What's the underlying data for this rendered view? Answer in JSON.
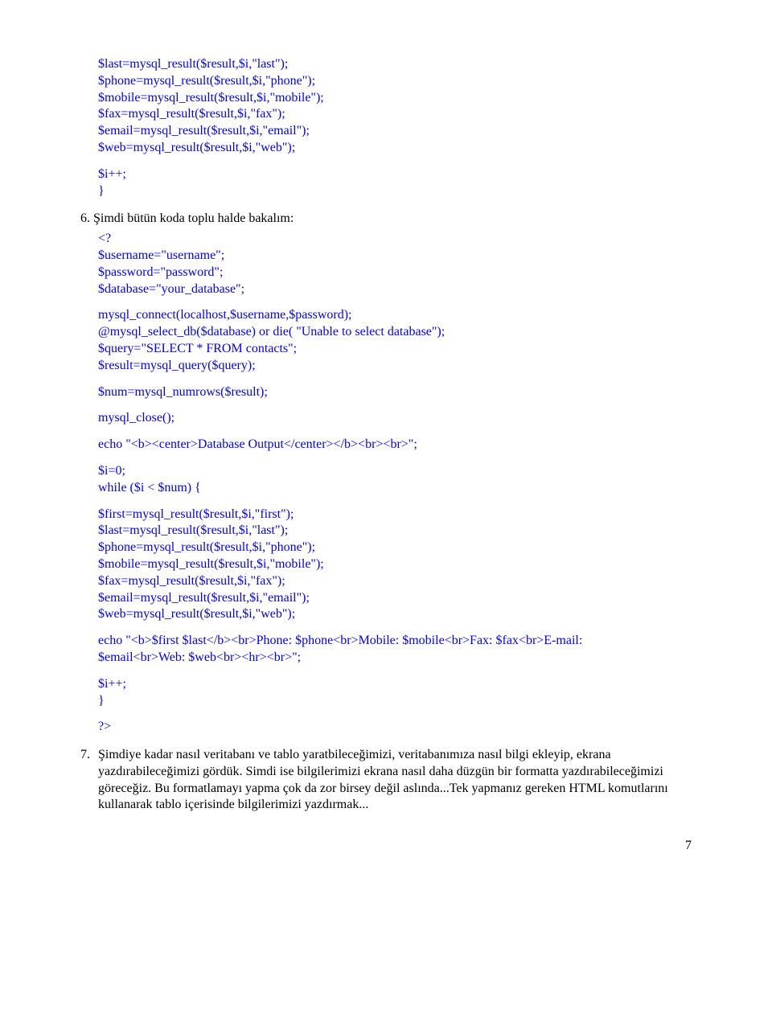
{
  "code": {
    "block1": {
      "l1": "$last=mysql_result($result,$i,\"last\");",
      "l2": "$phone=mysql_result($result,$i,\"phone\");",
      "l3": "$mobile=mysql_result($result,$i,\"mobile\");",
      "l4": "$fax=mysql_result($result,$i,\"fax\");",
      "l5": "$email=mysql_result($result,$i,\"email\");",
      "l6": "$web=mysql_result($result,$i,\"web\");"
    },
    "block2": {
      "l1": "$i++;",
      "l2": "}"
    },
    "item6_label": "6.",
    "item6_text": "Şimdi bütün koda toplu halde bakalım:",
    "block3": {
      "l1": "<?",
      "l2": "$username=\"username\";",
      "l3": "$password=\"password\";",
      "l4": "$database=\"your_database\";"
    },
    "block4": {
      "l1": "mysql_connect(localhost,$username,$password);",
      "l2": "@mysql_select_db($database) or die( \"Unable to select database\");",
      "l3": "$query=\"SELECT * FROM contacts\";",
      "l4": "$result=mysql_query($query);"
    },
    "block5": "$num=mysql_numrows($result);",
    "block6": "mysql_close();",
    "block7": "echo \"<b><center>Database Output</center></b><br><br>\";",
    "block8": {
      "l1": "$i=0;",
      "l2": "while ($i < $num) {"
    },
    "block9": {
      "l1": "$first=mysql_result($result,$i,\"first\");",
      "l2": "$last=mysql_result($result,$i,\"last\");",
      "l3": "$phone=mysql_result($result,$i,\"phone\");",
      "l4": "$mobile=mysql_result($result,$i,\"mobile\");",
      "l5": "$fax=mysql_result($result,$i,\"fax\");",
      "l6": "$email=mysql_result($result,$i,\"email\");",
      "l7": "$web=mysql_result($result,$i,\"web\");"
    },
    "block10": {
      "l1": "echo \"<b>$first $last</b><br>Phone: $phone<br>Mobile: $mobile<br>Fax: $fax<br>E-mail:",
      "l2": "$email<br>Web: $web<br><hr><br>\";"
    },
    "block11": {
      "l1": "$i++;",
      "l2": "}"
    },
    "block12": "?>"
  },
  "item7": {
    "label": "7.",
    "text": "Şimdiye kadar nasıl veritabanı ve tablo yaratbileceğimizi, veritabanımıza nasıl bilgi ekleyip, ekrana yazdırabileceğimizi gördük. Simdi ise bilgilerimizi ekrana nasıl daha düzgün bir formatta yazdırabileceğimizi göreceğiz. Bu formatlamayı yapma çok da zor birsey değil aslında...Tek yapmanız gereken HTML komutlarını kullanarak tablo içerisinde bilgilerimizi yazdırmak..."
  },
  "page_number": "7"
}
